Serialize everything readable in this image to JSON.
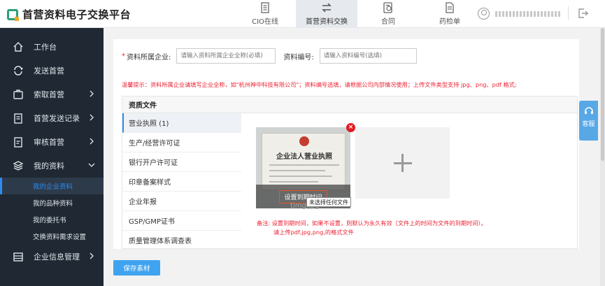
{
  "header": {
    "logo_text": "首营资料电子交换平台",
    "nav": [
      {
        "label": "CIO在线",
        "icon": "cio-icon",
        "active": false
      },
      {
        "label": "首营资料交换",
        "icon": "exchange-icon",
        "active": true
      },
      {
        "label": "合同",
        "icon": "contract-icon",
        "active": false
      },
      {
        "label": "药检单",
        "icon": "report-icon",
        "active": false
      }
    ]
  },
  "sidebar": {
    "items": [
      {
        "label": "工作台",
        "icon": "home-icon"
      },
      {
        "label": "发送首营",
        "icon": "send-icon"
      },
      {
        "label": "索取首营",
        "icon": "request-icon"
      },
      {
        "label": "首营发送记录",
        "icon": "record-icon"
      },
      {
        "label": "审核首营",
        "icon": "audit-icon"
      },
      {
        "label": "我的资料",
        "icon": "layers-icon"
      },
      {
        "label": "企业信息管理",
        "icon": "company-icon"
      }
    ],
    "sub_items": [
      "我的企业资料",
      "我的品种资料",
      "我的委托书",
      "交换资料需求设置"
    ]
  },
  "form": {
    "company_label": "资料所属企业:",
    "company_placeholder": "请输入资料所属企业全称(必填)",
    "code_label": "资料编号:",
    "code_placeholder": "请输入资料编号(选填)",
    "hint": "温馨提示：资料所属企业请填写企业全称，如\"杭州神中科技有限公司\"；资料编号选填，请根据公司内部情况使用；上传文件类型支持 jpg、png、pdf 格式;"
  },
  "panel": {
    "title": "资质文件",
    "docs": [
      "营业执照 (1)",
      "生产/经营许可证",
      "银行开户许可证",
      "印章备案样式",
      "企业年报",
      "GSP/GMP证书",
      "质量管理体系调查表"
    ]
  },
  "upload": {
    "cert_title": "企业法人营业执照",
    "set_date_label": "设置到期时间",
    "delete_label": "×",
    "file_name": "timg.jpg",
    "tooltip": "未选择任何文件",
    "note_line1": "备注: 设置到期时间，如果不设置，则默认为永久有效（文件上的时间为文件的到期时间）。",
    "note_line2": "请上传pdf,jpg,png,的格式文件"
  },
  "actions": {
    "save_label": "保存素材"
  },
  "service": {
    "label": "客服"
  },
  "colors": {
    "sidebar_bg": "#1f2833",
    "accent": "#2d8cf0",
    "warning": "#e22233",
    "button": "#3fa3f0"
  }
}
